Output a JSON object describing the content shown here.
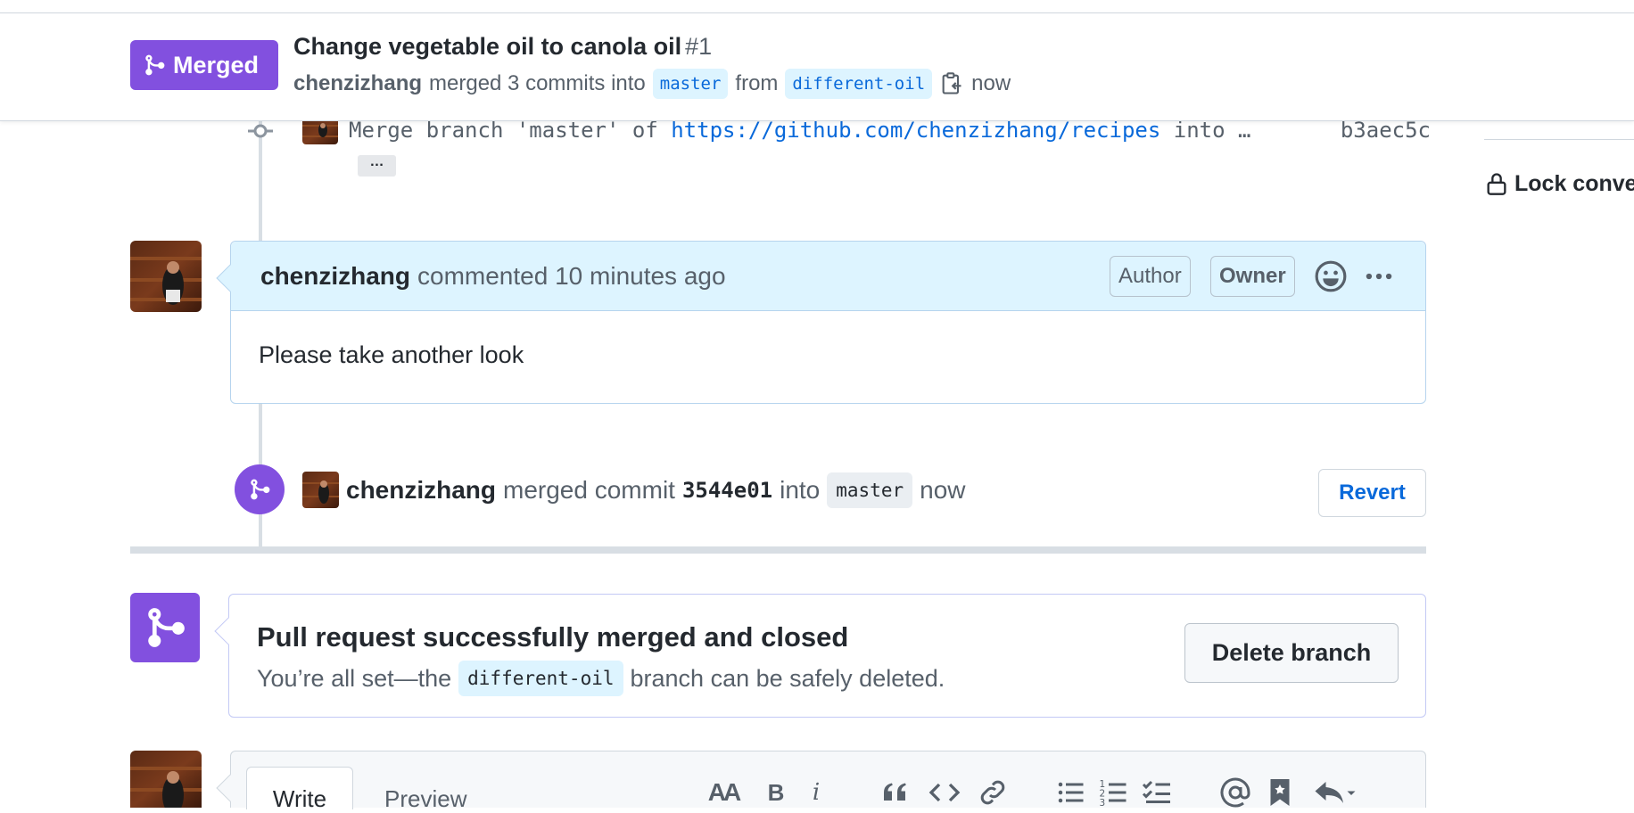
{
  "header": {
    "status_badge": "Merged",
    "title": "Change vegetable oil to canola oil",
    "number": "#1",
    "author": "chenzizhang",
    "merged_text": "merged 3 commits into",
    "base_branch": "master",
    "from_text": "from",
    "head_branch": "different-oil",
    "time": "now"
  },
  "commit": {
    "message_prefix": "Merge branch 'master' of",
    "link": "https://github.com/chenzizhang/recipes",
    "message_suffix": "into …",
    "sha": "b3aec5c",
    "ellipsis": "…"
  },
  "comment": {
    "author": "chenzizhang",
    "action": "commented",
    "time": "10 minutes ago",
    "label_author": "Author",
    "label_owner": "Owner",
    "body": "Please take another look"
  },
  "merge_event": {
    "author": "chenzizhang",
    "action": "merged commit",
    "sha": "3544e01",
    "into": "into",
    "branch": "master",
    "time": "now",
    "revert_label": "Revert"
  },
  "merge_status": {
    "title": "Pull request successfully merged and closed",
    "sub_prefix": "You’re all set—the",
    "branch": "different-oil",
    "sub_suffix": "branch can be safely deleted.",
    "delete_label": "Delete branch"
  },
  "composer": {
    "tab_write": "Write",
    "tab_preview": "Preview",
    "toolbar": {
      "heading": "AA",
      "bold": "B",
      "italic": "i"
    }
  },
  "sidebar": {
    "lock_label": "Lock conversation"
  },
  "colors": {
    "merged_purple": "#8250df",
    "link_blue": "#0969da",
    "comment_header_bg": "#ddf4ff"
  }
}
